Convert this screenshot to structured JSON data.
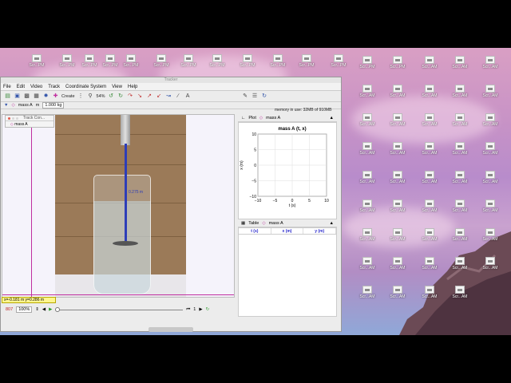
{
  "window": {
    "title": "Tracker",
    "menu": [
      "File",
      "Edit",
      "Video",
      "Track",
      "Coordinate System",
      "View",
      "Help"
    ],
    "toolbar": {
      "create_label": "Create",
      "zoom_label": "54%",
      "text_tool_label": "A"
    },
    "toolbar2": {
      "track_name": "mass A",
      "mass_prefix": "m",
      "mass_value": "1.000 kg"
    },
    "memory_text": "memory in use: 32MB of 910MB"
  },
  "track_control": {
    "title": "Track Con...",
    "item": "mass A"
  },
  "video": {
    "measure_label": "0.275 m"
  },
  "coord_readout": "x=-0.181 m  y=0.286 m",
  "player": {
    "frame": "807",
    "rate": "100%",
    "step": "1"
  },
  "plot_panel": {
    "tab_label": "Plot",
    "track": "mass A"
  },
  "table_panel": {
    "tab_label": "Table",
    "track": "mass A",
    "columns": [
      "t (s)",
      "x (m)",
      "y (m)"
    ]
  },
  "chart_data": {
    "type": "scatter",
    "title": "mass A (t, x)",
    "xlabel": "t (s)",
    "ylabel": "x (m)",
    "xlim": [
      -10,
      10
    ],
    "ylim": [
      -10,
      10
    ],
    "xticks": [
      -10,
      -5,
      0,
      5,
      10
    ],
    "yticks": [
      -10,
      -5,
      0,
      5,
      10
    ],
    "x": [],
    "y": [],
    "grid": true
  },
  "desktop": {
    "icons": [
      "Scr...PM",
      "Scr...PM",
      "Scr...PM",
      "Scr...PM",
      "Scr...PM",
      "Scr...PM",
      "Scr...PM",
      "Scr...PM",
      "Scr...PM",
      "Scr...PM",
      "Scr...PM",
      "Scr...PM",
      "Scr...PM",
      "Scr...PM",
      "Scr...AM",
      "Scr...AM",
      "Scr...AM",
      "Scr...AM",
      "Scr...AM",
      "Scr...AM",
      "Scr...AM",
      "Scr...AM",
      "Scr...AM",
      "Scr...AM",
      "Scr...AM",
      "Scr...AM",
      "Scr...AM",
      "Scr...AM",
      "Scr...AM",
      "Scr...AM",
      "Scr...AM",
      "Scr...AM",
      "Scr...AM",
      "Scr...AM",
      "Scr...AM",
      "Scr...AM",
      "Scr...AM",
      "Scr...AM",
      "Scr...AM",
      "Scr...AM",
      "Scr...AM",
      "Scr...AM",
      "Scr...AM",
      "Scr...AM",
      "Scr...AM",
      "Scr...AM",
      "Scr...AM",
      "Scr...AM",
      "Scr...AM",
      "Scr...AM",
      "Scr...AM",
      "Scr...AM",
      "Scr...AM",
      "Scr...AM",
      "Scr...AM",
      "Scr...AM"
    ]
  },
  "colors": {
    "track_magenta": "#c02fa0",
    "rod_blue": "#2d3db8",
    "readout_yellow": "#fff68f"
  }
}
